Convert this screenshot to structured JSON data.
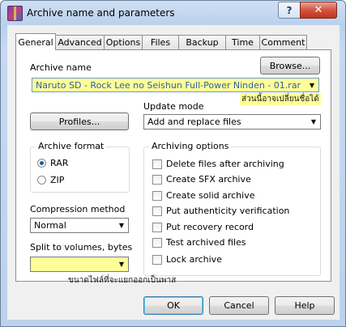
{
  "window": {
    "title": "Archive name and parameters",
    "help_glyph": "?",
    "close_glyph": "✕"
  },
  "tabs": [
    "General",
    "Advanced",
    "Options",
    "Files",
    "Backup",
    "Time",
    "Comment"
  ],
  "active_tab": "General",
  "archive_name": {
    "label": "Archive name",
    "value": "Naruto SD - Rock Lee no Seishun Full-Power Ninden - 01.rar",
    "browse_label": "Browse...",
    "annotation": "ส่วนนี้อาจเปลี่ยนชื่อได้"
  },
  "profiles_label": "Profiles...",
  "update_mode": {
    "label": "Update mode",
    "value": "Add and replace files"
  },
  "archive_format": {
    "title": "Archive format",
    "options": [
      {
        "label": "RAR",
        "selected": true
      },
      {
        "label": "ZIP",
        "selected": false
      }
    ]
  },
  "compression": {
    "label": "Compression method",
    "value": "Normal"
  },
  "split": {
    "label": "Split to volumes, bytes",
    "value": "",
    "annotation": "ขนาดไฟล์ที่จะแยกออกเป็นพาส"
  },
  "archiving_options": {
    "title": "Archiving options",
    "items": [
      {
        "label": "Delete files after archiving",
        "checked": false
      },
      {
        "label": "Create SFX archive",
        "checked": false
      },
      {
        "label": "Create solid archive",
        "checked": false
      },
      {
        "label": "Put authenticity verification",
        "checked": false
      },
      {
        "label": "Put recovery record",
        "checked": false
      },
      {
        "label": "Test archived files",
        "checked": false
      },
      {
        "label": "Lock archive",
        "checked": false
      }
    ]
  },
  "buttons": {
    "ok": "OK",
    "cancel": "Cancel",
    "help": "Help"
  },
  "colors": {
    "highlight": "#ffff99",
    "close_button": "#c8432e",
    "selection_text": "#1f5fa6"
  }
}
